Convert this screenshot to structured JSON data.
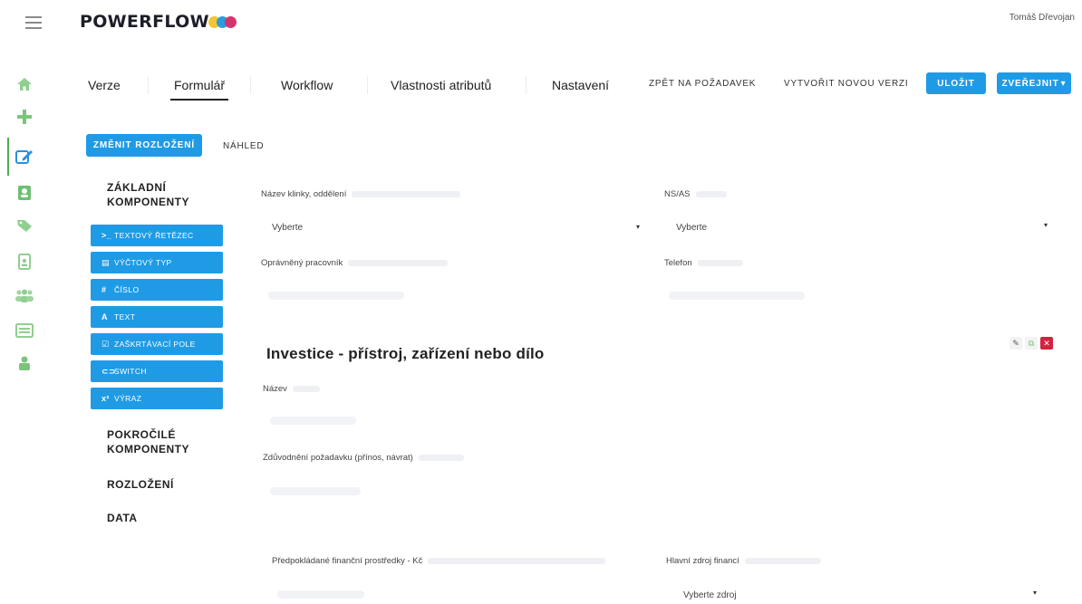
{
  "app": {
    "logo_text": "POWERFLOW",
    "logo_dot_colors": [
      "#f4c534",
      "#2d9cdb",
      "#d6336c"
    ],
    "user_name": "Tomáš Dřevojan"
  },
  "rail": {
    "icons": [
      "home-icon",
      "plus-icon",
      "edit-icon",
      "contact-icon",
      "tag-icon",
      "badge-icon",
      "users-icon",
      "list-icon",
      "person-icon"
    ],
    "active_index": 2
  },
  "tabs": [
    {
      "label": "Verze"
    },
    {
      "label": "Formulář"
    },
    {
      "label": "Workflow"
    },
    {
      "label": "Vlastnosti atributů"
    },
    {
      "label": "Nastavení"
    }
  ],
  "actions": {
    "back_label": "ZPĚT NA POŽADAVEK",
    "new_version_label": "VYTVOŘIT NOVOU VERZI",
    "save_label": "ULOŽIT",
    "publish_label": "ZVEŘEJNIT",
    "publish_caret": "▾"
  },
  "toolbar": {
    "change_layout_label": "ZMĚNIT ROZLOŽENÍ",
    "preview_label": "NÁHLED"
  },
  "palette": {
    "basic_title": "ZÁKLADNÍ KOMPONENTY",
    "components": [
      {
        "icon": ">_",
        "label": "TEXTOVÝ ŘETĚZEC"
      },
      {
        "icon": "▤",
        "label": "VÝČTOVÝ TYP"
      },
      {
        "icon": "#",
        "label": "ČÍSLO"
      },
      {
        "icon": "A",
        "label": "TEXT"
      },
      {
        "icon": "☑",
        "label": "ZAŠKRTÁVACÍ POLE"
      },
      {
        "icon": "⊂⊃",
        "label": "SWITCH"
      },
      {
        "icon": "x²",
        "label": "VÝRAZ"
      }
    ],
    "advanced_title": "POKROČILÉ KOMPONENTY",
    "layout_title": "ROZLOŽENÍ",
    "data_title": "DATA"
  },
  "form": {
    "field_dept_label": "Název klinky, oddělení",
    "field_dept_select": "Vyberte",
    "field_ns_label": "NS/AS",
    "field_ns_select": "Vyberte",
    "field_worker_label": "Oprávněný pracovník",
    "field_phone_label": "Telefon",
    "section_title": "Investice - přístroj, zařízení nebo dílo",
    "field_name_label": "Název",
    "field_justification_label": "Zdůvodnění požadavku (přínos, návrat)",
    "field_funds_label": "Předpokládané finanční prostředky - Kč",
    "field_source_label": "Hlavní zdroj financí",
    "field_source_select": "Vyberte zdroj",
    "caret": "▾"
  }
}
